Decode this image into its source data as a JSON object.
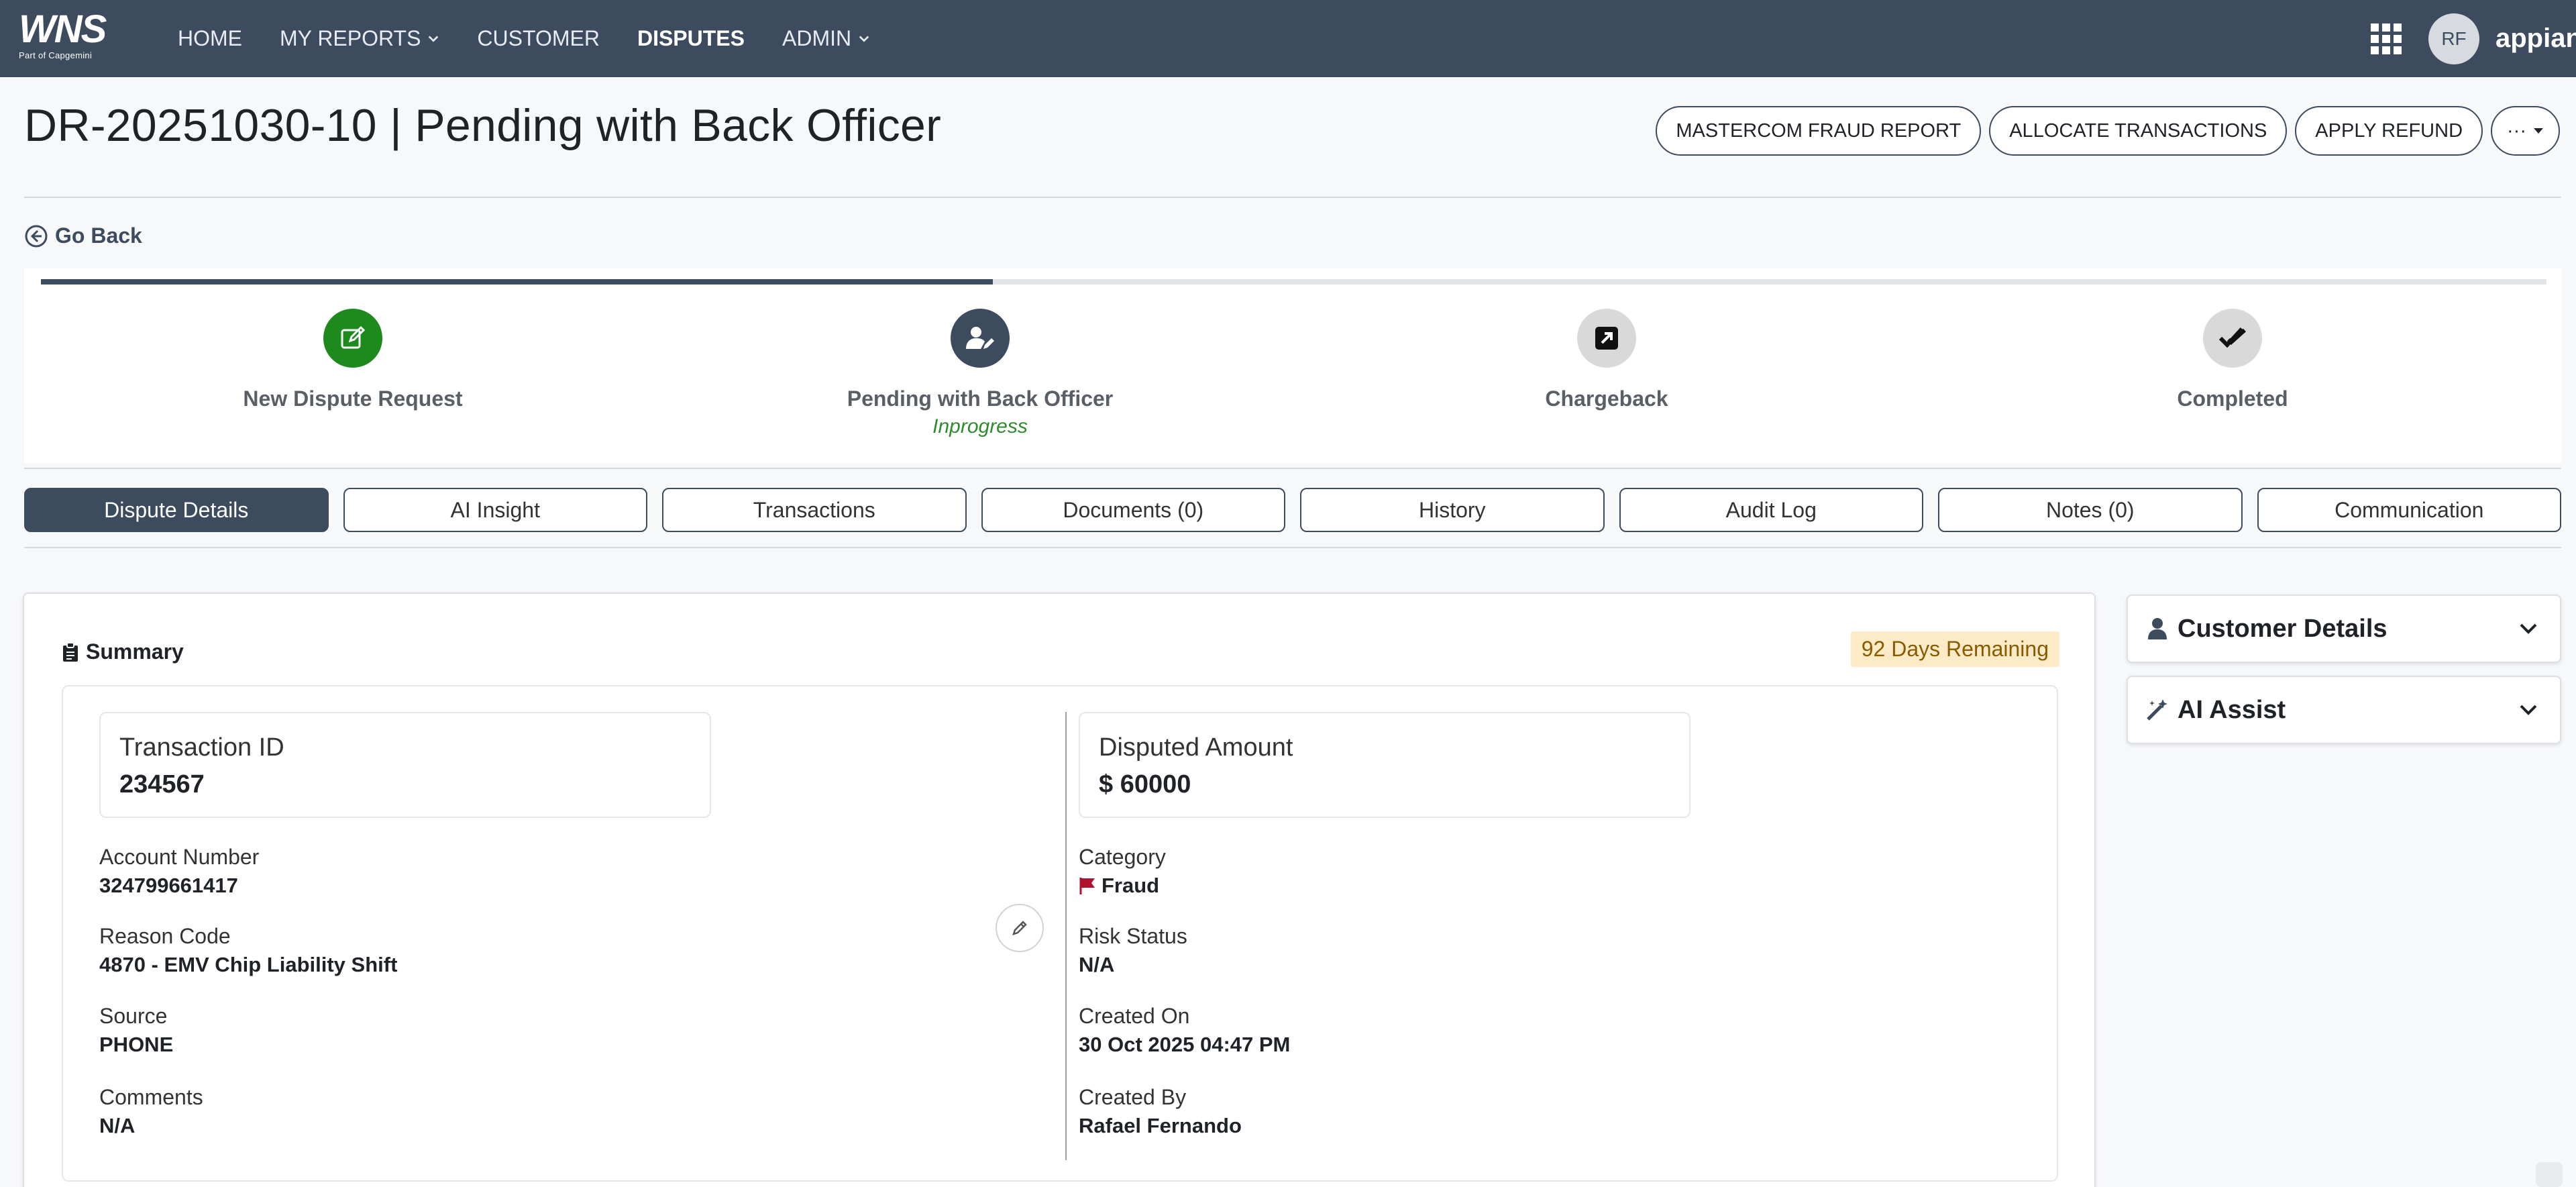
{
  "nav": {
    "logo_text": "WNS",
    "logo_sub": "Part of Capgemini",
    "items": [
      {
        "label": "HOME",
        "dropdown": false,
        "active": false
      },
      {
        "label": "MY REPORTS",
        "dropdown": true,
        "active": false
      },
      {
        "label": "CUSTOMER",
        "dropdown": false,
        "active": false
      },
      {
        "label": "DISPUTES",
        "dropdown": false,
        "active": true
      },
      {
        "label": "ADMIN",
        "dropdown": true,
        "active": false
      }
    ],
    "avatar_initials": "RF",
    "brand": "appian"
  },
  "header": {
    "title": "DR-20251030-10 | Pending with Back Officer",
    "actions": [
      "MASTERCOM FRAUD REPORT",
      "ALLOCATE TRANSACTIONS",
      "APPLY REFUND"
    ],
    "more_label": "···"
  },
  "go_back": "Go Back",
  "progress": {
    "fraction_complete": 0.38,
    "steps": [
      {
        "label": "New Dispute Request",
        "sub": "",
        "icon": "edit-icon",
        "color": "#1e8a1e"
      },
      {
        "label": "Pending with Back Officer",
        "sub": "Inprogress",
        "icon": "user-edit-icon",
        "color": "#3d4b5e"
      },
      {
        "label": "Chargeback",
        "sub": "",
        "icon": "external-link-icon",
        "color": "#d9d9d9"
      },
      {
        "label": "Completed",
        "sub": "",
        "icon": "double-check-icon",
        "color": "#d9d9d9"
      }
    ]
  },
  "tabs": [
    {
      "label": "Dispute Details",
      "active": true
    },
    {
      "label": "AI Insight",
      "active": false
    },
    {
      "label": "Transactions",
      "active": false
    },
    {
      "label": "Documents (0)",
      "active": false
    },
    {
      "label": "History",
      "active": false
    },
    {
      "label": "Audit Log",
      "active": false
    },
    {
      "label": "Notes (0)",
      "active": false
    },
    {
      "label": "Communication",
      "active": false
    }
  ],
  "summary": {
    "heading": "Summary",
    "days_remaining": "92 Days Remaining",
    "transaction_id": {
      "label": "Transaction ID",
      "value": "234567"
    },
    "disputed_amount": {
      "label": "Disputed Amount",
      "value": "$ 60000"
    },
    "left_fields": [
      {
        "label": "Account Number",
        "value": "324799661417"
      },
      {
        "label": "Reason Code",
        "value": "4870 - EMV Chip Liability Shift"
      },
      {
        "label": "Source",
        "value": "PHONE"
      },
      {
        "label": "Comments",
        "value": "N/A"
      }
    ],
    "right_fields": [
      {
        "label": "Category",
        "value": "Fraud"
      },
      {
        "label": "Risk Status",
        "value": "N/A"
      },
      {
        "label": "Created On",
        "value": "30 Oct 2025 04:47 PM"
      },
      {
        "label": "Created By",
        "value": "Rafael Fernando"
      }
    ]
  },
  "side_panels": [
    {
      "title": "Customer Details",
      "icon": "user-icon"
    },
    {
      "title": "AI Assist",
      "icon": "magic-wand-icon"
    }
  ],
  "colors": {
    "nav_bg": "#3d4b5e",
    "accent": "#3d4b5e",
    "success": "#1e8a1e",
    "badge_bg": "#fdebc8",
    "fraud_flag": "#b0122f"
  }
}
